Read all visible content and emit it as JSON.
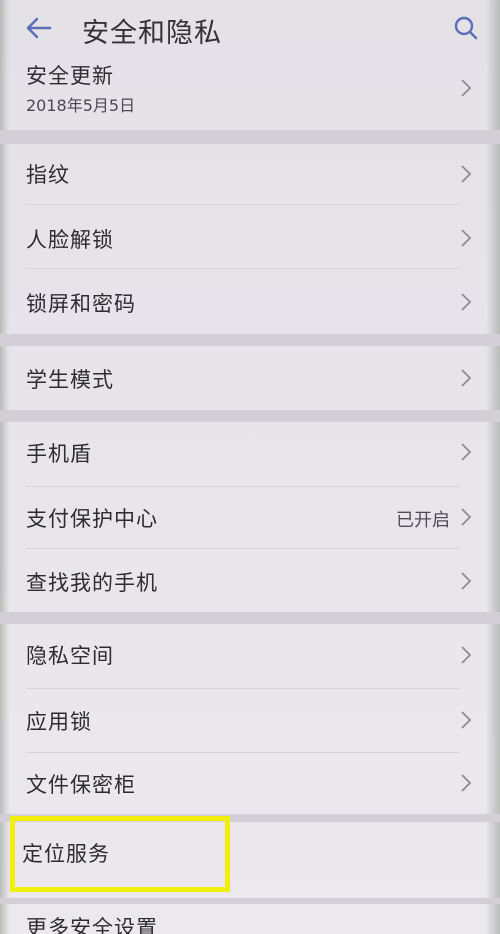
{
  "header": {
    "title": "安全和隐私"
  },
  "sections": {
    "security_update": {
      "label": "安全更新",
      "sub": "2018年5月5日"
    },
    "fingerprint": {
      "label": "指纹"
    },
    "face_unlock": {
      "label": "人脸解锁"
    },
    "lock_screen": {
      "label": "锁屏和密码"
    },
    "student_mode": {
      "label": "学生模式"
    },
    "phone_shield": {
      "label": "手机盾"
    },
    "payment_protection": {
      "label": "支付保护中心",
      "status": "已开启"
    },
    "find_my_phone": {
      "label": "查找我的手机"
    },
    "private_space": {
      "label": "隐私空间"
    },
    "app_lock": {
      "label": "应用锁"
    },
    "file_safe": {
      "label": "文件保密柜"
    },
    "location_service": {
      "label": "定位服务"
    },
    "more_security": {
      "label": "更多安全设置"
    }
  },
  "colors": {
    "accent": "#5a6fb8",
    "highlight": "#f2ee10"
  }
}
